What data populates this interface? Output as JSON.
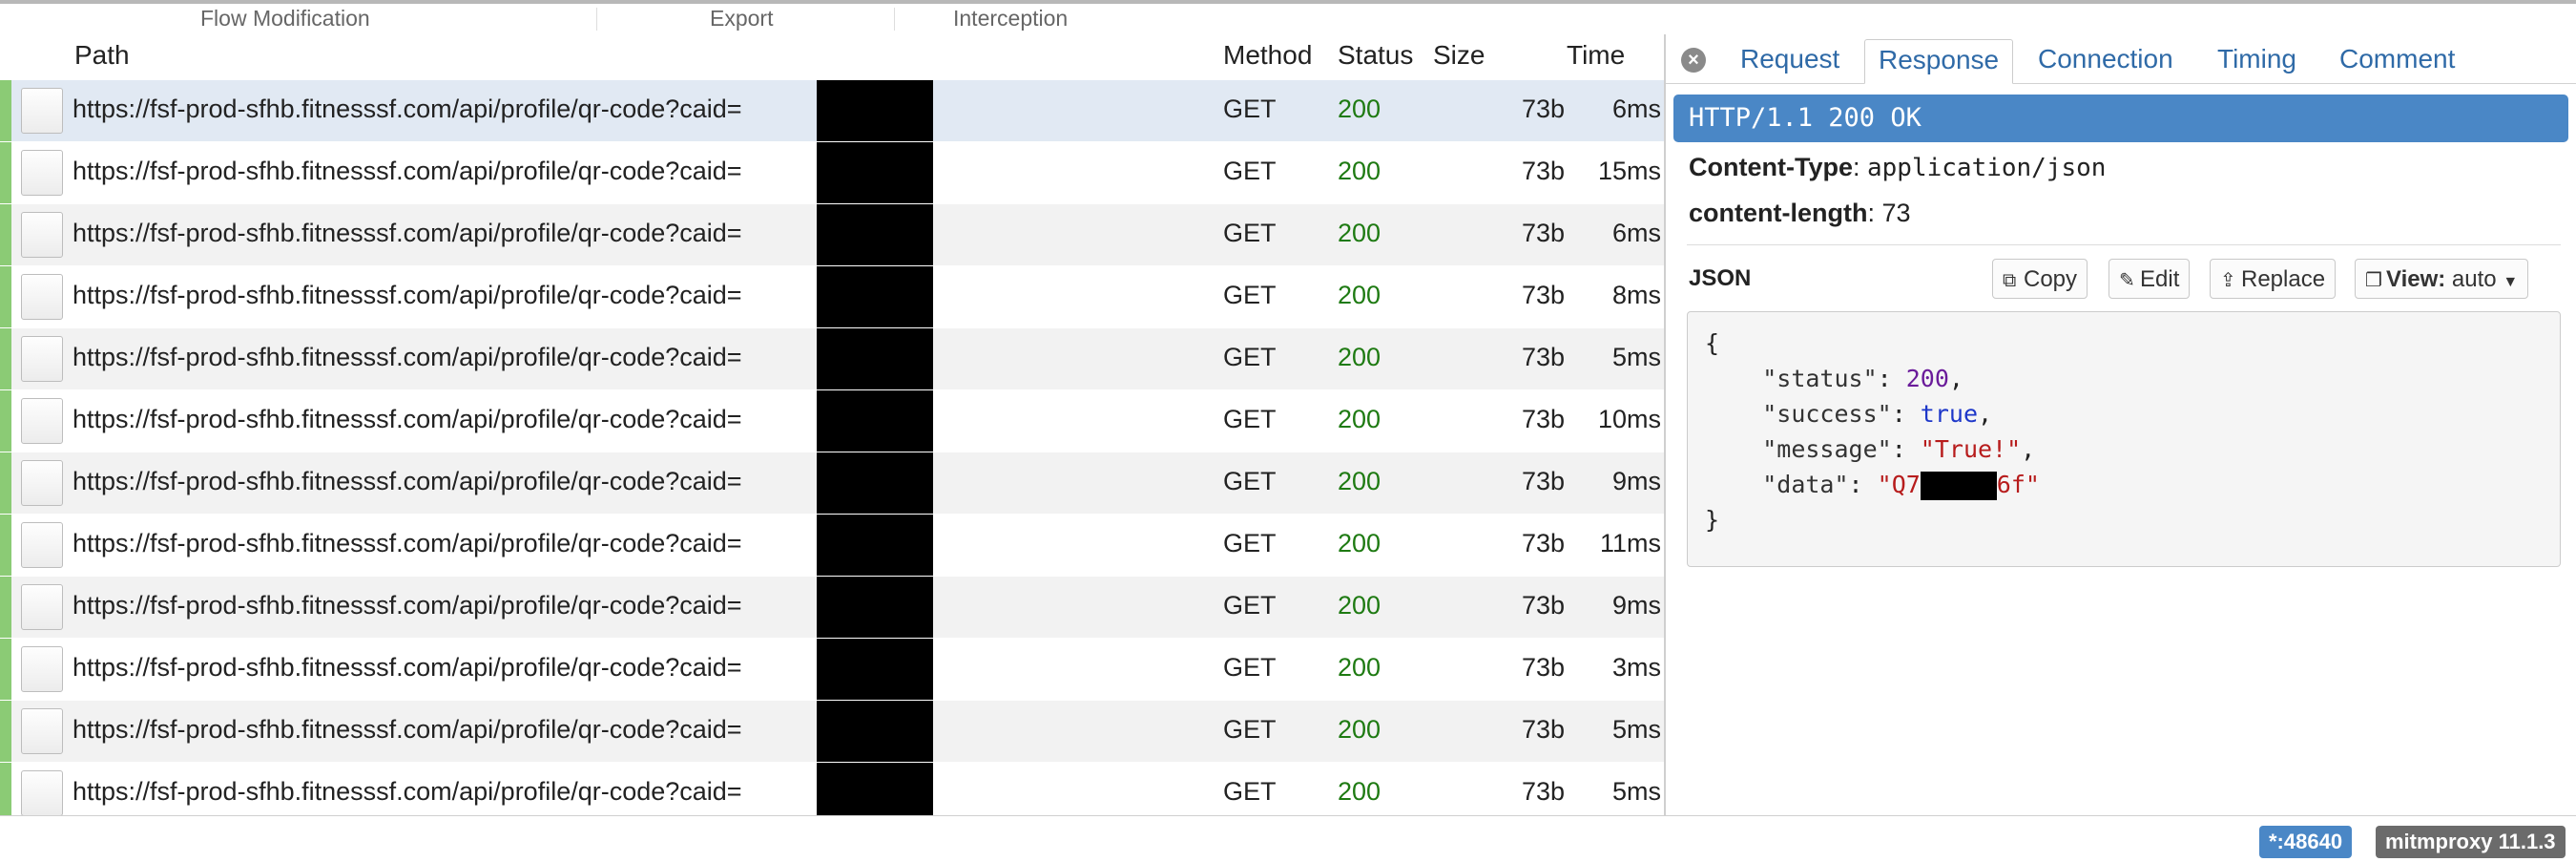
{
  "menu": {
    "sections": [
      "Flow Modification",
      "Export",
      "Interception"
    ]
  },
  "table": {
    "headers": {
      "path": "Path",
      "method": "Method",
      "status": "Status",
      "size": "Size",
      "time": "Time"
    },
    "rows": [
      {
        "path": "https://fsf-prod-sfhb.fitnesssf.com/api/profile/qr-code?caid=",
        "method": "GET",
        "status": "200",
        "size": "73b",
        "time": "6ms"
      },
      {
        "path": "https://fsf-prod-sfhb.fitnesssf.com/api/profile/qr-code?caid=",
        "method": "GET",
        "status": "200",
        "size": "73b",
        "time": "15ms"
      },
      {
        "path": "https://fsf-prod-sfhb.fitnesssf.com/api/profile/qr-code?caid=",
        "method": "GET",
        "status": "200",
        "size": "73b",
        "time": "6ms"
      },
      {
        "path": "https://fsf-prod-sfhb.fitnesssf.com/api/profile/qr-code?caid=",
        "method": "GET",
        "status": "200",
        "size": "73b",
        "time": "8ms"
      },
      {
        "path": "https://fsf-prod-sfhb.fitnesssf.com/api/profile/qr-code?caid=",
        "method": "GET",
        "status": "200",
        "size": "73b",
        "time": "5ms"
      },
      {
        "path": "https://fsf-prod-sfhb.fitnesssf.com/api/profile/qr-code?caid=",
        "method": "GET",
        "status": "200",
        "size": "73b",
        "time": "10ms"
      },
      {
        "path": "https://fsf-prod-sfhb.fitnesssf.com/api/profile/qr-code?caid=",
        "method": "GET",
        "status": "200",
        "size": "73b",
        "time": "9ms"
      },
      {
        "path": "https://fsf-prod-sfhb.fitnesssf.com/api/profile/qr-code?caid=",
        "method": "GET",
        "status": "200",
        "size": "73b",
        "time": "11ms"
      },
      {
        "path": "https://fsf-prod-sfhb.fitnesssf.com/api/profile/qr-code?caid=",
        "method": "GET",
        "status": "200",
        "size": "73b",
        "time": "9ms"
      },
      {
        "path": "https://fsf-prod-sfhb.fitnesssf.com/api/profile/qr-code?caid=",
        "method": "GET",
        "status": "200",
        "size": "73b",
        "time": "3ms"
      },
      {
        "path": "https://fsf-prod-sfhb.fitnesssf.com/api/profile/qr-code?caid=",
        "method": "GET",
        "status": "200",
        "size": "73b",
        "time": "5ms"
      },
      {
        "path": "https://fsf-prod-sfhb.fitnesssf.com/api/profile/qr-code?caid=",
        "method": "GET",
        "status": "200",
        "size": "73b",
        "time": "5ms"
      }
    ]
  },
  "details": {
    "close_icon": "close-icon",
    "tabs": [
      "Request",
      "Response",
      "Connection",
      "Timing",
      "Comment"
    ],
    "active_tab": "Response",
    "status_line": "HTTP/1.1 200 OK",
    "headers": [
      {
        "key": "Content-Type",
        "value": "application/json"
      },
      {
        "key": "content-length",
        "value": "73"
      }
    ],
    "content_view": {
      "label": "JSON",
      "copy_label": "Copy",
      "edit_label": "Edit",
      "replace_label": "Replace",
      "view_label": "View:",
      "view_value": "auto"
    },
    "json": {
      "open": "{",
      "close": "}",
      "status_key": "\"status\"",
      "status_val": "200",
      "success_key": "\"success\"",
      "success_val": "true",
      "message_key": "\"message\"",
      "message_val": "\"True!\"",
      "data_key": "\"data\"",
      "data_prefix": "\"Q7",
      "data_suffix": "6f\""
    }
  },
  "statusbar": {
    "port": "*:48640",
    "version": "mitmproxy 11.1.3"
  },
  "colors": {
    "accent": "#4a87c6",
    "status_ok": "#1e7a12",
    "row_marker": "#8bcb75",
    "selected_row": "#e1e9f3"
  }
}
